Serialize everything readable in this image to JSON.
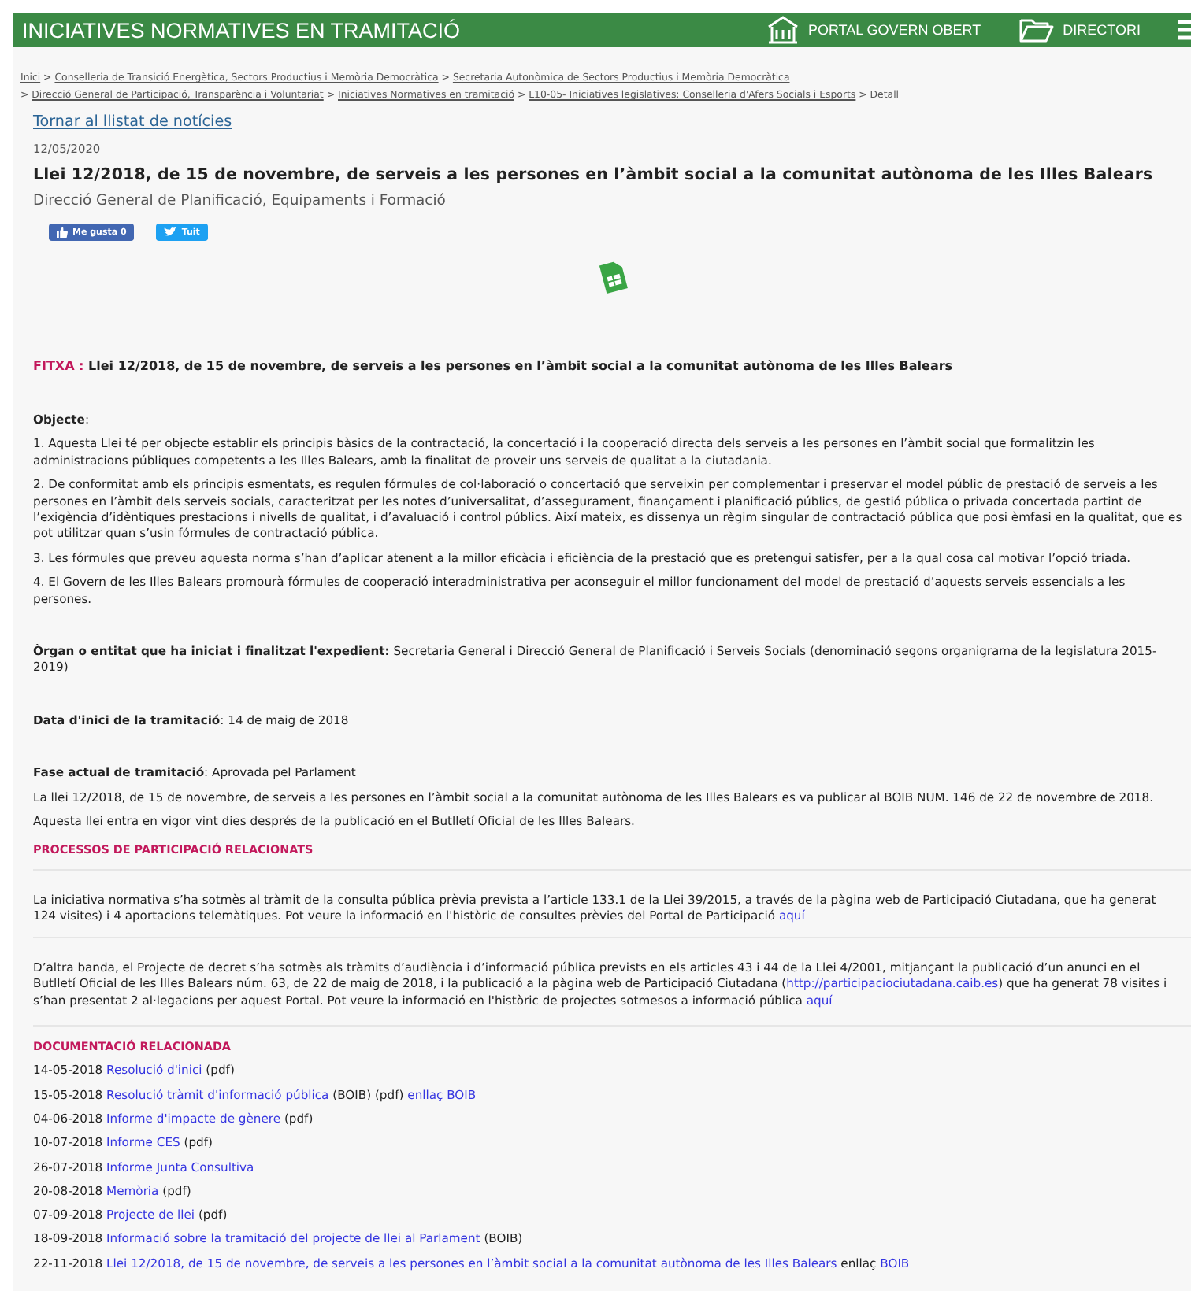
{
  "header": {
    "title": "INICIATIVES NORMATIVES EN TRAMITACIÓ",
    "links": [
      {
        "kind": "building",
        "label": "PORTAL GOVERN OBERT"
      },
      {
        "kind": "folder",
        "label": "DIRECTORI"
      }
    ]
  },
  "breadcrumb": [
    [
      {
        "kind": "link",
        "text": "Inici"
      },
      {
        "kind": "text",
        "text": " > "
      },
      {
        "kind": "link",
        "text": "Conselleria de Transició Energètica, Sectors Productius i Memòria Democràtica"
      },
      {
        "kind": "text",
        "text": " > "
      },
      {
        "kind": "link",
        "text": "Secretaria Autonòmica de Sectors Productius i Memòria Democràtica"
      }
    ],
    [
      {
        "kind": "text",
        "text": "> "
      },
      {
        "kind": "link",
        "text": "Direcció General de Participació, Transparència i Voluntariat"
      },
      {
        "kind": "text",
        "text": " > "
      },
      {
        "kind": "link",
        "text": "Iniciatives Normatives en tramitació"
      },
      {
        "kind": "text",
        "text": " > "
      },
      {
        "kind": "link",
        "text": "L10-05- Iniciatives legislatives: Conselleria d'Afers Socials i Esports"
      },
      {
        "kind": "text",
        "text": " > Detall"
      }
    ]
  ],
  "back_link": "Tornar al llistat de notícies",
  "date": "12/05/2020",
  "title": "Llei 12/2018, de 15 de novembre, de serveis a les persones en l’àmbit social a la comunitat autònoma de les Illes Balears",
  "department": "Direcció General de Planificació, Equipaments i Formació",
  "social": [
    {
      "kind": "like",
      "label": "Me gusta 0"
    },
    {
      "kind": "tweet",
      "label": "Tuit"
    }
  ],
  "blocks": [
    {
      "kind": "fitxa",
      "lines": [
        [
          {
            "kind": "label",
            "text": "FITXA : "
          },
          {
            "kind": "bold",
            "text": "Llei 12/2018, de 15 de novembre, de serveis a les persones en l’àmbit social a la comunitat autònoma de les Illes Balears"
          }
        ]
      ]
    },
    {
      "kind": "field",
      "lines": [
        [
          {
            "kind": "bold",
            "text": "Objecte"
          },
          {
            "kind": "text",
            "text": ":"
          }
        ]
      ]
    },
    {
      "kind": "paragraph",
      "lines": [
        [
          {
            "kind": "text",
            "text": "1. Aquesta Llei té per objecte establir els principis bàsics de la contractació, la concertació i la cooperació directa dels serveis a les persones en l’àmbit social que formalitzin les"
          }
        ],
        [
          {
            "kind": "text",
            "text": "administracions públiques competents a les Illes Balears, amb la finalitat de proveir uns serveis de qualitat a la ciutadania."
          }
        ]
      ]
    },
    {
      "kind": "paragraph",
      "lines": [
        [
          {
            "kind": "text",
            "text": "2. De conformitat amb els principis esmentats, es regulen fórmules de col·laboració o concertació que serveixin per complementar i preservar el model públic de prestació de serveis a les"
          }
        ],
        [
          {
            "kind": "text",
            "text": "persones en l’àmbit dels serveis socials, caracteritzat per les notes d’universalitat, d’assegurament, finançament i planificació públics, de gestió pública o privada concertada partint de"
          }
        ],
        [
          {
            "kind": "text",
            "text": "l’exigència d’idèntiques prestacions i nivells de qualitat, i d’avaluació i control públics. Així mateix, es dissenya un règim singular de contractació pública que posi èmfasi en la qualitat, que es"
          }
        ],
        [
          {
            "kind": "text",
            "text": "pot utilitzar quan s’usin fórmules de contractació pública."
          }
        ]
      ]
    },
    {
      "kind": "paragraph",
      "lines": [
        [
          {
            "kind": "text",
            "text": "3. Les fórmules que preveu aquesta norma s’han d’aplicar atenent a la millor eficàcia i eficiència de la prestació que es pretengui satisfer, per a la qual cosa cal motivar l’opció triada."
          }
        ]
      ]
    },
    {
      "kind": "paragraph",
      "lines": [
        [
          {
            "kind": "text",
            "text": "4. El Govern de les Illes Balears promourà fórmules de cooperació interadministrativa per aconseguir el millor funcionament del model de prestació d’aquests serveis essencials a les"
          }
        ],
        [
          {
            "kind": "text",
            "text": "persones."
          }
        ]
      ]
    },
    {
      "kind": "field",
      "lines": [
        [
          {
            "kind": "bold",
            "text": "Òrgan o entitat que ha iniciat i finalitzat l'expedient:"
          },
          {
            "kind": "text",
            "text": " Secretaria General i Direcció General de Planificació i Serveis Socials (denominació segons organigrama de la legislatura 2015-"
          }
        ],
        [
          {
            "kind": "text",
            "text": "2019)"
          }
        ]
      ]
    },
    {
      "kind": "field",
      "lines": [
        [
          {
            "kind": "bold",
            "text": "Data d'inici de la tramitació"
          },
          {
            "kind": "text",
            "text": ": 14 de maig de 2018"
          }
        ]
      ]
    },
    {
      "kind": "field",
      "lines": [
        [
          {
            "kind": "bold",
            "text": "Fase actual de tramitació"
          },
          {
            "kind": "text",
            "text": ": Aprovada pel Parlament"
          }
        ]
      ]
    },
    {
      "kind": "paragraph",
      "lines": [
        [
          {
            "kind": "text",
            "text": "La llei 12/2018, de 15 de novembre, de serveis a les persones en l’àmbit social a la comunitat autònoma de les Illes Balears es va publicar al BOIB NUM. 146 de 22 de novembre de 2018."
          }
        ]
      ]
    },
    {
      "kind": "paragraph",
      "lines": [
        [
          {
            "kind": "text",
            "text": "Aquesta llei entra en vigor vint dies després de la publicació en el Butlletí Oficial de les Illes Balears."
          }
        ]
      ]
    },
    {
      "kind": "heading",
      "lines": [
        [
          {
            "kind": "label",
            "text": "PROCESSOS DE PARTICIPACIÓ RELACIONATS"
          }
        ]
      ]
    },
    {
      "kind": "section",
      "lines": [
        [
          {
            "kind": "text",
            "text": "La iniciativa normativa s’ha sotmès al tràmit de la consulta pública prèvia prevista a l’article 133.1 de la Llei 39/2015, a través de la pàgina web de Participació Ciutadana, que ha generat"
          }
        ],
        [
          {
            "kind": "text",
            "text": "124 visites) i 4 aportacions telemàtiques. Pot veure la informació en l'històric de consultes prèvies del Portal de Participació "
          },
          {
            "kind": "link",
            "text": "aquí"
          }
        ]
      ]
    },
    {
      "kind": "section",
      "lines": [
        [
          {
            "kind": "text",
            "text": "D’altra banda, el Projecte de decret s’ha sotmès als tràmits d’audiència i d’informació pública prevists en els articles 43 i 44 de la Llei 4/2001, mitjançant la publicació d’un anunci en el"
          }
        ],
        [
          {
            "kind": "text",
            "text": "Butlletí Oficial de les Illes Balears núm. 63, de 22 de maig de 2018, i la publicació a la pàgina web de Participació Ciutadana ("
          },
          {
            "kind": "link",
            "text": "http://participaciociutadana.caib.es"
          },
          {
            "kind": "text",
            "text": ") que ha generat 78 visites i"
          }
        ],
        [
          {
            "kind": "text",
            "text": "s’han presentat 2 al·legacions per aquest Portal. Pot veure la informació en l'històric de projectes sotmesos a informació pública "
          },
          {
            "kind": "link",
            "text": "aquí"
          }
        ]
      ]
    },
    {
      "kind": "heading",
      "lines": [
        [
          {
            "kind": "label",
            "text": "DOCUMENTACIÓ RELACIONADA"
          }
        ]
      ]
    },
    {
      "kind": "document",
      "lines": [
        [
          {
            "kind": "text",
            "text": "14-05-2018 "
          },
          {
            "kind": "link",
            "text": "Resolució d'inici"
          },
          {
            "kind": "text",
            "text": " (pdf)"
          }
        ]
      ]
    },
    {
      "kind": "document",
      "lines": [
        [
          {
            "kind": "text",
            "text": "15-05-2018 "
          },
          {
            "kind": "link",
            "text": "Resolució tràmit d'informació pública"
          },
          {
            "kind": "text",
            "text": " (BOIB) (pdf) "
          },
          {
            "kind": "link",
            "text": "enllaç BOIB"
          }
        ]
      ]
    },
    {
      "kind": "document",
      "lines": [
        [
          {
            "kind": "text",
            "text": "04-06-2018 "
          },
          {
            "kind": "link",
            "text": "Informe d'impacte de gènere"
          },
          {
            "kind": "text",
            "text": " (pdf)"
          }
        ]
      ]
    },
    {
      "kind": "document",
      "lines": [
        [
          {
            "kind": "text",
            "text": "10-07-2018 "
          },
          {
            "kind": "link",
            "text": "Informe CES"
          },
          {
            "kind": "text",
            "text": " (pdf)"
          }
        ]
      ]
    },
    {
      "kind": "document",
      "lines": [
        [
          {
            "kind": "text",
            "text": "26-07-2018 "
          },
          {
            "kind": "link",
            "text": "Informe Junta Consultiva"
          }
        ]
      ]
    },
    {
      "kind": "document",
      "lines": [
        [
          {
            "kind": "text",
            "text": "20-08-2018 "
          },
          {
            "kind": "link",
            "text": "Memòria"
          },
          {
            "kind": "text",
            "text": " (pdf)"
          }
        ]
      ]
    },
    {
      "kind": "document",
      "lines": [
        [
          {
            "kind": "text",
            "text": "07-09-2018 "
          },
          {
            "kind": "link",
            "text": "Projecte de llei"
          },
          {
            "kind": "text",
            "text": " (pdf)"
          }
        ]
      ]
    },
    {
      "kind": "document",
      "lines": [
        [
          {
            "kind": "text",
            "text": "18-09-2018 "
          },
          {
            "kind": "link",
            "text": "Informació sobre la tramitació del projecte de llei al Parlament"
          },
          {
            "kind": "text",
            "text": " (BOIB)"
          }
        ]
      ]
    },
    {
      "kind": "document",
      "lines": [
        [
          {
            "kind": "text",
            "text": "22-11-2018 "
          },
          {
            "kind": "link",
            "text": "Llei 12/2018, de 15 de novembre, de serveis a les persones en l’àmbit social a la comunitat autònoma de les Illes Balears"
          },
          {
            "kind": "text",
            "text": " enllaç "
          },
          {
            "kind": "link",
            "text": "BOIB"
          }
        ]
      ]
    }
  ]
}
